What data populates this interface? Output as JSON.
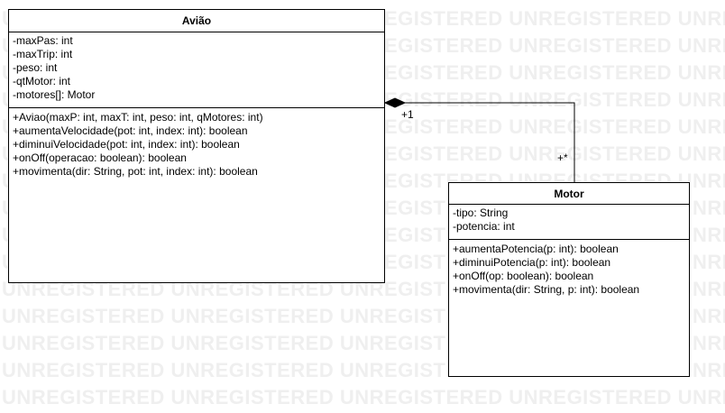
{
  "watermark_text": "UNREGISTERED",
  "classes": {
    "aviao": {
      "name": "Avião",
      "attributes": [
        "-maxPas: int",
        "-maxTrip: int",
        "-peso: int",
        "-qtMotor: int",
        "-motores[]: Motor"
      ],
      "operations": [
        "+Aviao(maxP: int, maxT: int, peso: int, qMotores: int)",
        "+aumentaVelocidade(pot: int, index: int): boolean",
        "+diminuiVelocidade(pot: int, index: int): boolean",
        "+onOff(operacao: boolean): boolean",
        "+movimenta(dir: String, pot: int, index: int): boolean"
      ]
    },
    "motor": {
      "name": "Motor",
      "attributes": [
        "-tipo: String",
        "-potencia: int"
      ],
      "operations": [
        "+aumentaPotencia(p: int): boolean",
        "+diminuiPotencia(p: int): boolean",
        "+onOff(op: boolean): boolean",
        "+movimenta(dir: String, p: int): boolean"
      ]
    }
  },
  "association": {
    "type": "composition",
    "source_multiplicity": "+1",
    "target_multiplicity": "+*"
  },
  "colors": {
    "line": "#000000",
    "background": "#ffffff",
    "watermark": "#efefef"
  }
}
